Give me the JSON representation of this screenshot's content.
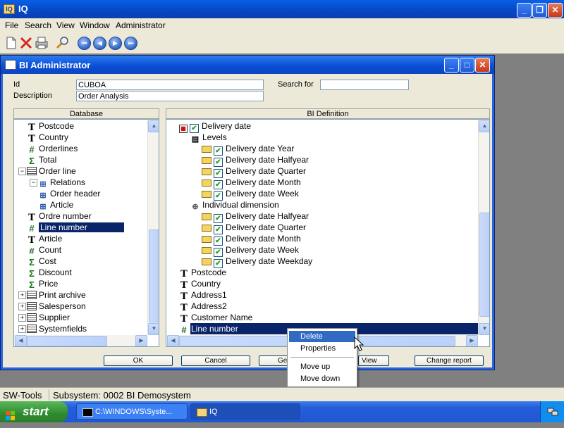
{
  "app": {
    "title": "IQ",
    "icon_text": "IQ",
    "menu": [
      "File",
      "Search",
      "View",
      "Window",
      "Administrator"
    ]
  },
  "toolbar_icons": [
    "new-document-icon",
    "delete-icon",
    "print-icon",
    "zoom-icon",
    "first-record-icon",
    "previous-record-icon",
    "next-record-icon",
    "last-record-icon"
  ],
  "bi_window": {
    "title": "BI Administrator",
    "id_label": "Id",
    "id_value": "CUBOA",
    "description_label": "Description",
    "description_value": "Order Analysis",
    "search_label": "Search for",
    "search_value": "",
    "database_header": "Database",
    "definition_header": "BI Definition",
    "database_tree": [
      {
        "label": "Postcode",
        "icon": "text-field-icon"
      },
      {
        "label": "Country",
        "icon": "text-field-icon"
      },
      {
        "label": "Orderlines",
        "icon": "number-field-icon"
      },
      {
        "label": "Total",
        "icon": "sum-field-icon"
      },
      {
        "label": "Order line",
        "icon": "table-icon"
      },
      {
        "label": "Relations",
        "icon": "relations-icon"
      },
      {
        "label": "Order header",
        "icon": "relations-icon"
      },
      {
        "label": "Article",
        "icon": "relations-icon"
      },
      {
        "label": "Ordre number",
        "icon": "text-field-icon"
      },
      {
        "label": "Line number",
        "icon": "number-field-icon"
      },
      {
        "label": "Article",
        "icon": "text-field-icon"
      },
      {
        "label": "Count",
        "icon": "number-field-icon"
      },
      {
        "label": "Cost",
        "icon": "sum-field-icon"
      },
      {
        "label": "Discount",
        "icon": "sum-field-icon"
      },
      {
        "label": "Price",
        "icon": "sum-field-icon"
      },
      {
        "label": "Print archive",
        "icon": "table-icon"
      },
      {
        "label": "Salesperson",
        "icon": "table-icon"
      },
      {
        "label": "Supplier",
        "icon": "table-icon"
      },
      {
        "label": "Systemfields",
        "icon": "table-icon"
      }
    ],
    "definition_tree": [
      {
        "label": "Delivery date",
        "icon": "calendar-icon"
      },
      {
        "label": "Levels",
        "icon": "levels-icon"
      },
      {
        "label": "Delivery date Year",
        "icon": "level-folder-icon"
      },
      {
        "label": "Delivery date Halfyear",
        "icon": "level-folder-icon"
      },
      {
        "label": "Delivery date Quarter",
        "icon": "level-folder-icon"
      },
      {
        "label": "Delivery date Month",
        "icon": "level-folder-icon"
      },
      {
        "label": "Delivery date Week",
        "icon": "level-folder-icon"
      },
      {
        "label": "Individual dimension",
        "icon": "dimension-icon"
      },
      {
        "label": "Delivery date Halfyear",
        "icon": "level-folder-icon"
      },
      {
        "label": "Delivery date Quarter",
        "icon": "level-folder-icon"
      },
      {
        "label": "Delivery date Month",
        "icon": "level-folder-icon"
      },
      {
        "label": "Delivery date Week",
        "icon": "level-folder-icon"
      },
      {
        "label": "Delivery date Weekday",
        "icon": "level-folder-icon"
      },
      {
        "label": "Postcode",
        "icon": "text-field-icon"
      },
      {
        "label": "Country",
        "icon": "text-field-icon"
      },
      {
        "label": "Address1",
        "icon": "text-field-icon"
      },
      {
        "label": "Address2",
        "icon": "text-field-icon"
      },
      {
        "label": "Customer Name",
        "icon": "text-field-icon"
      },
      {
        "label": "Line number",
        "icon": "number-field-icon"
      }
    ],
    "buttons": {
      "ok": "OK",
      "cancel": "Cancel",
      "gen": "Ge",
      "view": "View",
      "change_report": "Change report"
    }
  },
  "context_menu": {
    "items": [
      "Delete",
      "Properties",
      "Move up",
      "Move down"
    ],
    "highlighted": "Delete"
  },
  "statusbar": {
    "left": "SW-Tools",
    "right": "Subsystem: 0002 BI Demosystem"
  },
  "taskbar": {
    "start_label": "start",
    "tasks": [
      "C:\\WINDOWS\\Syste...",
      "IQ"
    ]
  },
  "colors": {
    "selection": "#0a246a",
    "menu_highlight": "#316ac5",
    "window_face": "#ece9d8",
    "titlebar_blue": "#0a4fd6"
  }
}
